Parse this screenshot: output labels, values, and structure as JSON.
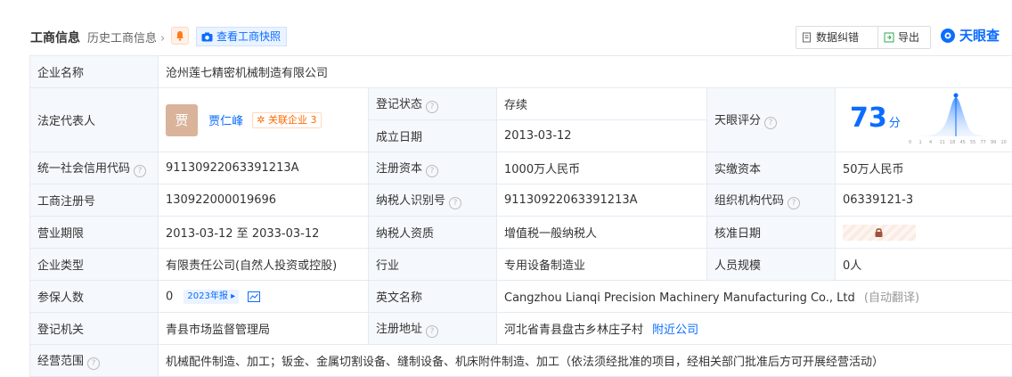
{
  "header": {
    "title": "工商信息",
    "history": "历史工商信息",
    "snapshot_label": "查看工商快照",
    "correction_label": "数据纠错",
    "export_label": "导出",
    "brand": "天眼查"
  },
  "rows": {
    "company_name": {
      "label": "企业名称",
      "value": "沧州莲七精密机械制造有限公司"
    },
    "legal_rep": {
      "label": "法定代表人",
      "avatar": "贾",
      "name": "贾仁峰",
      "tag": "关联企业",
      "tag_count": "3"
    },
    "reg_status": {
      "label": "登记状态",
      "value": "存续"
    },
    "est_date": {
      "label": "成立日期",
      "value": "2013-03-12"
    },
    "tianyan_score": {
      "label": "天眼评分",
      "value": "73",
      "unit": "分"
    },
    "credit_code": {
      "label": "统一社会信用代码",
      "value": "91130922063391213A"
    },
    "reg_capital": {
      "label": "注册资本",
      "value": "1000万人民币"
    },
    "paid_capital": {
      "label": "实缴资本",
      "value": "50万人民币"
    },
    "reg_number": {
      "label": "工商注册号",
      "value": "130922000019696"
    },
    "taxpayer_id": {
      "label": "纳税人识别号",
      "value": "91130922063391213A"
    },
    "org_code": {
      "label": "组织机构代码",
      "value": "06339121-3"
    },
    "business_term": {
      "label": "营业期限",
      "value": "2013-03-12 至 2033-03-12"
    },
    "taxpayer_qual": {
      "label": "纳税人资质",
      "value": "增值税一般纳税人"
    },
    "approval_date": {
      "label": "核准日期"
    },
    "company_type": {
      "label": "企业类型",
      "value": "有限责任公司(自然人投资或控股)"
    },
    "industry": {
      "label": "行业",
      "value": "专用设备制造业"
    },
    "staff_size": {
      "label": "人员规模",
      "value": "0人"
    },
    "insured": {
      "label": "参保人数",
      "value": "0",
      "year_tag": "2023年报"
    },
    "english_name": {
      "label": "英文名称",
      "value": "Cangzhou Lianqi Precision Machinery Manufacturing Co., Ltd",
      "note": "(自动翻译)"
    },
    "authority": {
      "label": "登记机关",
      "value": "青县市场监督管理局"
    },
    "address": {
      "label": "注册地址",
      "value": "河北省青县盘古乡林庄子村",
      "link": "附近公司"
    },
    "scope": {
      "label": "经营范围",
      "value": "机械配件制造、加工；钣金、金属切割设备、缝制设备、机床附件制造、加工（依法须经批准的项目，经相关部门批准后方可开展经营活动）"
    }
  },
  "score_chart": {
    "ticks": [
      "0",
      "1",
      "4",
      "11",
      "18",
      "45",
      "55",
      "77",
      "99",
      "100"
    ]
  }
}
